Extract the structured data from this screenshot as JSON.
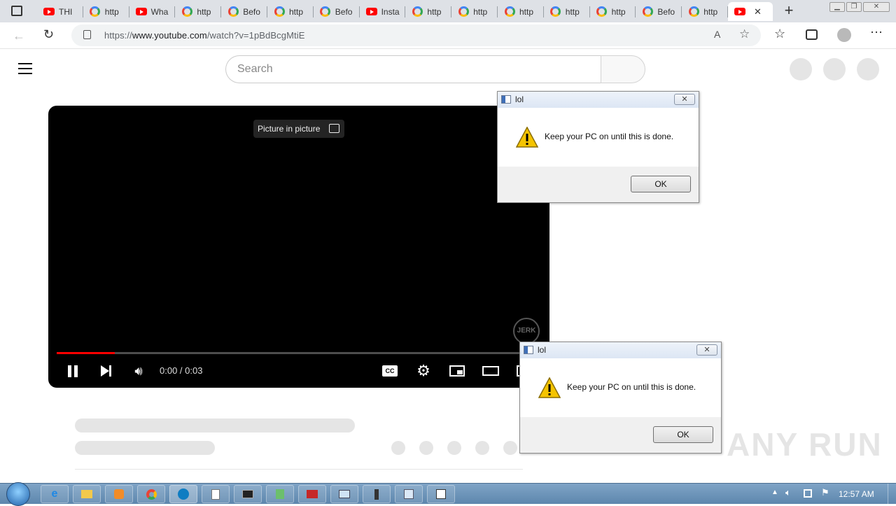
{
  "browser": {
    "tabs": [
      {
        "label": "THI",
        "icon": "youtube-icon"
      },
      {
        "label": "http",
        "icon": "google-icon"
      },
      {
        "label": "Wha",
        "icon": "youtube-icon"
      },
      {
        "label": "http",
        "icon": "google-icon"
      },
      {
        "label": "Befo",
        "icon": "google-icon"
      },
      {
        "label": "http",
        "icon": "google-icon"
      },
      {
        "label": "Befo",
        "icon": "google-icon"
      },
      {
        "label": "Insta",
        "icon": "youtube-icon"
      },
      {
        "label": "http",
        "icon": "google-icon"
      },
      {
        "label": "http",
        "icon": "google-icon"
      },
      {
        "label": "http",
        "icon": "google-icon"
      },
      {
        "label": "http",
        "icon": "google-icon"
      },
      {
        "label": "http",
        "icon": "google-icon"
      },
      {
        "label": "Befo",
        "icon": "google-icon"
      },
      {
        "label": "http",
        "icon": "google-icon"
      },
      {
        "label": "",
        "icon": "youtube-icon"
      }
    ],
    "url_prefix": "https://",
    "url_domain": "www.youtube.com",
    "url_path": "/watch?v=1pBdBcgMtiE"
  },
  "youtube": {
    "search_placeholder": "Search",
    "pip_tooltip": "Picture in picture",
    "time": "0:00 / 0:03",
    "progress_fraction": 0.12,
    "channel_watermark": "JERK"
  },
  "dialogs": [
    {
      "title": "lol",
      "message": "Keep your PC on until this is done.",
      "ok_label": "OK",
      "close_label": "✕"
    },
    {
      "title": "lol",
      "message": "Keep your PC on until this is done.",
      "ok_label": "OK",
      "close_label": "✕"
    }
  ],
  "taskbar": {
    "clock": "12:57 AM"
  },
  "watermark": "ANY RUN",
  "colors": {
    "youtube_red": "#ff0000",
    "taskbar": "#6b93b8",
    "dialog_bg": "#f0f0f0"
  }
}
